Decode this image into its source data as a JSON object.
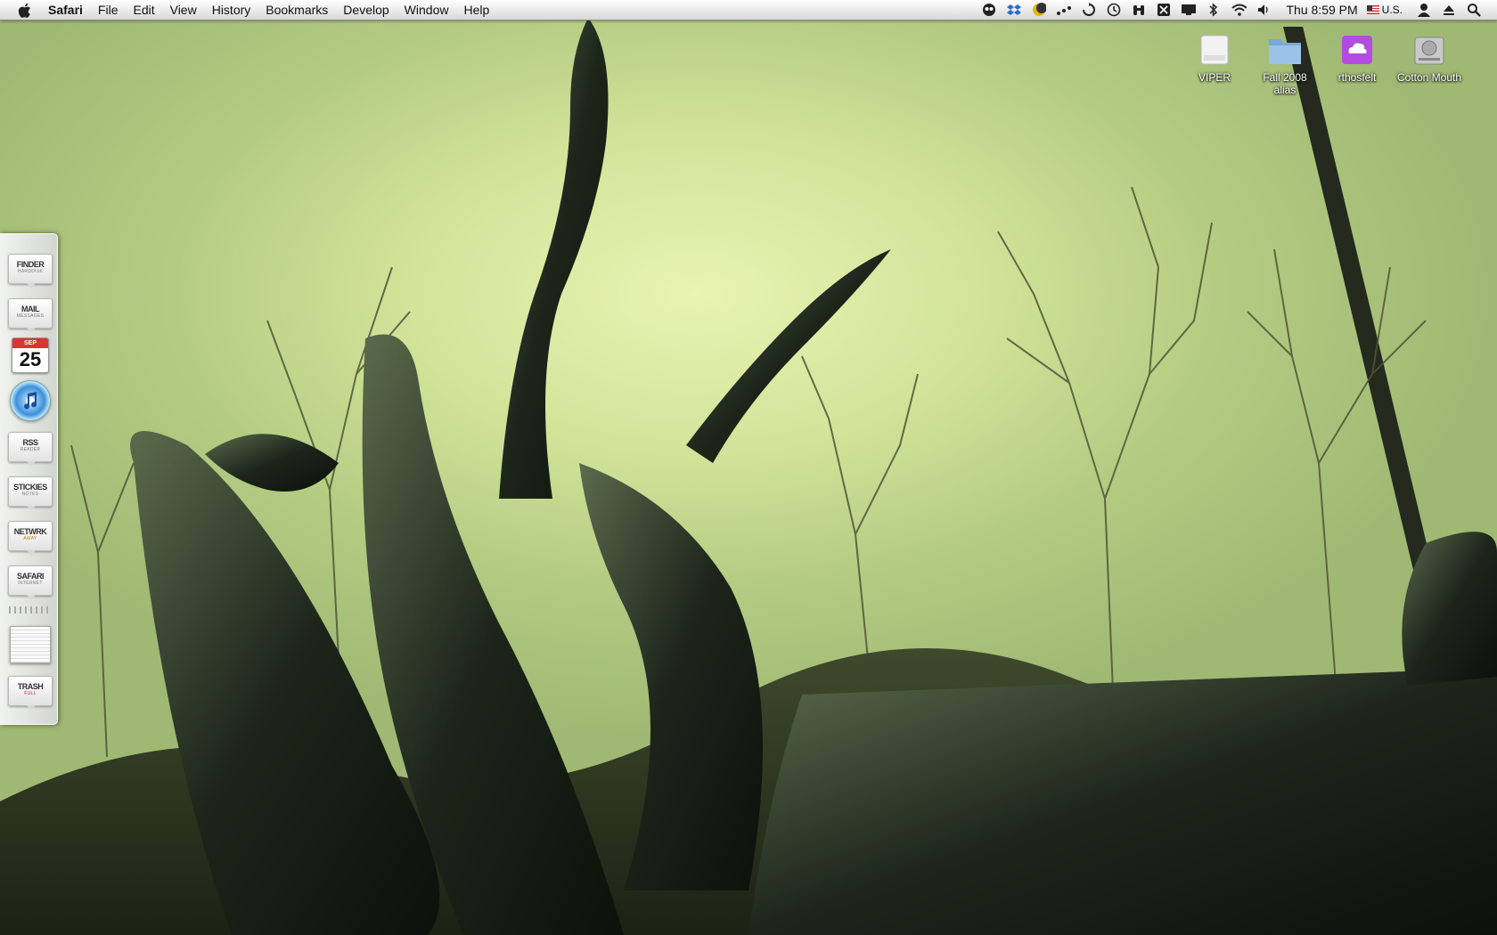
{
  "menubar": {
    "app_name": "Safari",
    "menus": [
      "File",
      "Edit",
      "View",
      "History",
      "Bookmarks",
      "Develop",
      "Window",
      "Help"
    ],
    "status_icons": [
      "alien-icon",
      "dropbox-icon",
      "moon-icon",
      "dots-icon",
      "sync-icon",
      "time-machine-icon",
      "binoculars-icon",
      "scissors-icon",
      "display-icon",
      "bluetooth-icon",
      "wifi-icon",
      "volume-icon"
    ],
    "clock": "Thu 8:59 PM",
    "input_language": "U.S."
  },
  "desktop_icons": [
    {
      "label": "VIPER",
      "icon": "external-drive-icon"
    },
    {
      "label": "Fall 2008 alias",
      "icon": "folder-icon"
    },
    {
      "label": "rthosfelt",
      "icon": "idisk-icon"
    },
    {
      "label": "Cotton Mouth",
      "icon": "hard-drive-icon"
    }
  ],
  "dock": {
    "finder": {
      "title": "FINDER",
      "subtitle": "HARDDISK"
    },
    "mail": {
      "title": "MAIL",
      "subtitle": "MESSAGES"
    },
    "calendar": {
      "month": "SEP",
      "day": "25"
    },
    "itunes": {
      "icon": "itunes-icon"
    },
    "rss": {
      "title": "RSS",
      "subtitle": "READER"
    },
    "stickies": {
      "title": "STICKIES",
      "subtitle": "NOTES"
    },
    "network": {
      "title": "NETWRK",
      "subtitle": "AWAY"
    },
    "safari": {
      "title": "SAFARI",
      "subtitle": "INTERNET"
    },
    "trash": {
      "title": "TRASH",
      "subtitle": "FULL"
    }
  }
}
